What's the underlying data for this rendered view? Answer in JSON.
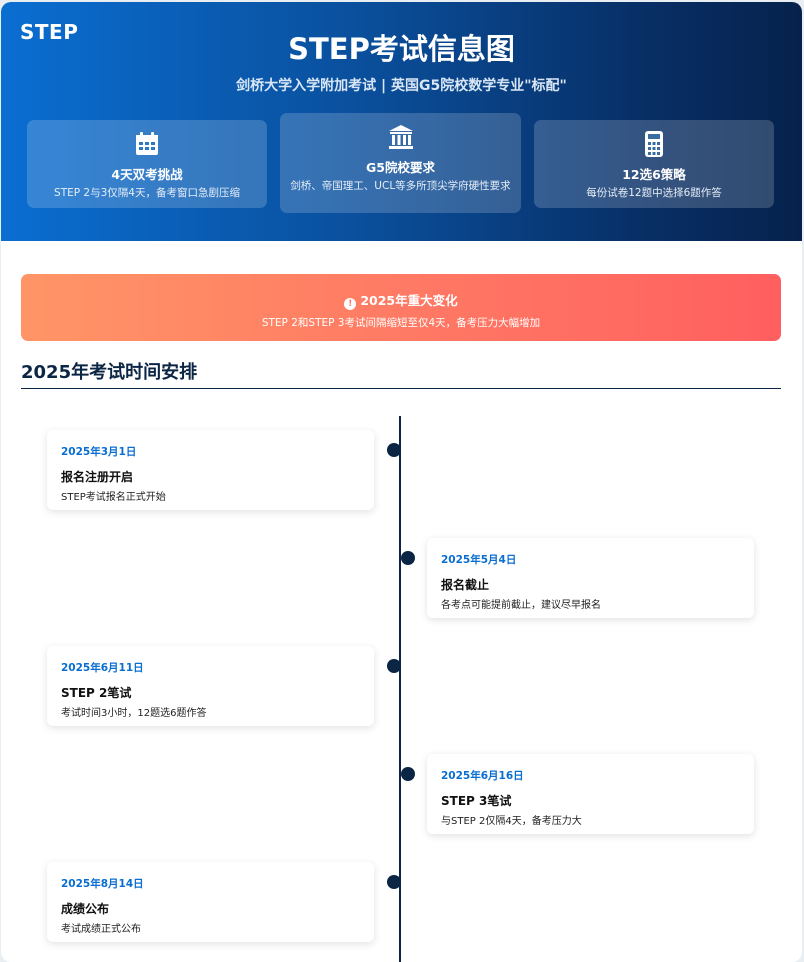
{
  "header": {
    "brand": "STEP",
    "title": "STEP考试信息图",
    "subtitle": "剑桥大学入学附加考试 | 英国G5院校数学专业\"标配\"",
    "features": [
      {
        "icon": "calendar-icon",
        "title": "4天双考挑战",
        "desc": "STEP 2与3仅隔4天，备考窗口急剧压缩"
      },
      {
        "icon": "university-icon",
        "title": "G5院校要求",
        "desc": "剑桥、帝国理工、UCL等多所顶尖学府硬性要求"
      },
      {
        "icon": "calculator-icon",
        "title": "12选6策略",
        "desc": "每份试卷12题中选择6题作答"
      }
    ]
  },
  "alert": {
    "icon": "info-icon",
    "title": "2025年重大变化",
    "desc": "STEP 2和STEP 3考试间隔缩短至仅4天，备考压力大幅增加"
  },
  "timeline": {
    "section_title": "2025年考试时间安排",
    "events": [
      {
        "date": "2025年3月1日",
        "name": "报名注册开启",
        "desc": "STEP考试报名正式开始"
      },
      {
        "date": "2025年5月4日",
        "name": "报名截止",
        "desc": "各考点可能提前截止，建议尽早报名"
      },
      {
        "date": "2025年6月11日",
        "name": "STEP 2笔试",
        "desc": "考试时间3小时，12题选6题作答"
      },
      {
        "date": "2025年6月16日",
        "name": "STEP 3笔试",
        "desc": "与STEP 2仅隔4天，备考压力大"
      },
      {
        "date": "2025年8月14日",
        "name": "成绩公布",
        "desc": "考试成绩正式公布"
      }
    ]
  },
  "colors": {
    "header_start": "#0a6ed1",
    "header_end": "#06224c",
    "alert_start": "#ff9566",
    "alert_end": "#ff5f5f",
    "accent_date": "#0a6ed1",
    "navy": "#0b2545"
  }
}
